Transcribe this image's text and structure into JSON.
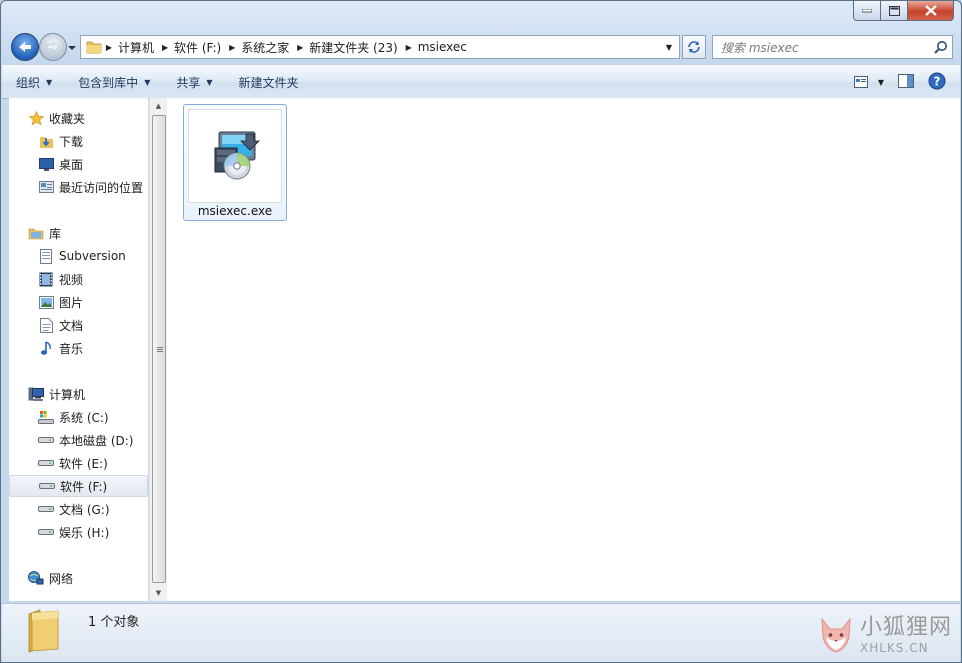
{
  "window": {
    "breadcrumb": [
      "计算机",
      "软件 (F:)",
      "系统之家",
      "新建文件夹 (23)",
      "msiexec"
    ],
    "search_placeholder": "搜索 msiexec"
  },
  "toolbar": {
    "organize": "组织",
    "include_in_library": "包含到库中",
    "share": "共享",
    "new_folder": "新建文件夹"
  },
  "nav": {
    "favorites": {
      "label": "收藏夹",
      "items": [
        "下载",
        "桌面",
        "最近访问的位置"
      ]
    },
    "libraries": {
      "label": "库",
      "items": [
        "Subversion",
        "视频",
        "图片",
        "文档",
        "音乐"
      ]
    },
    "computer": {
      "label": "计算机",
      "items": [
        "系统 (C:)",
        "本地磁盘 (D:)",
        "软件 (E:)",
        "软件 (F:)",
        "文档 (G:)",
        "娱乐 (H:)"
      ],
      "selected": "软件 (F:)"
    },
    "network": {
      "label": "网络"
    }
  },
  "files": [
    {
      "name": "msiexec.exe",
      "icon": "installer-icon"
    }
  ],
  "status": {
    "text": "1 个对象"
  },
  "watermark": {
    "line1": "小狐狸网",
    "line2": "XHLKS.CN"
  }
}
